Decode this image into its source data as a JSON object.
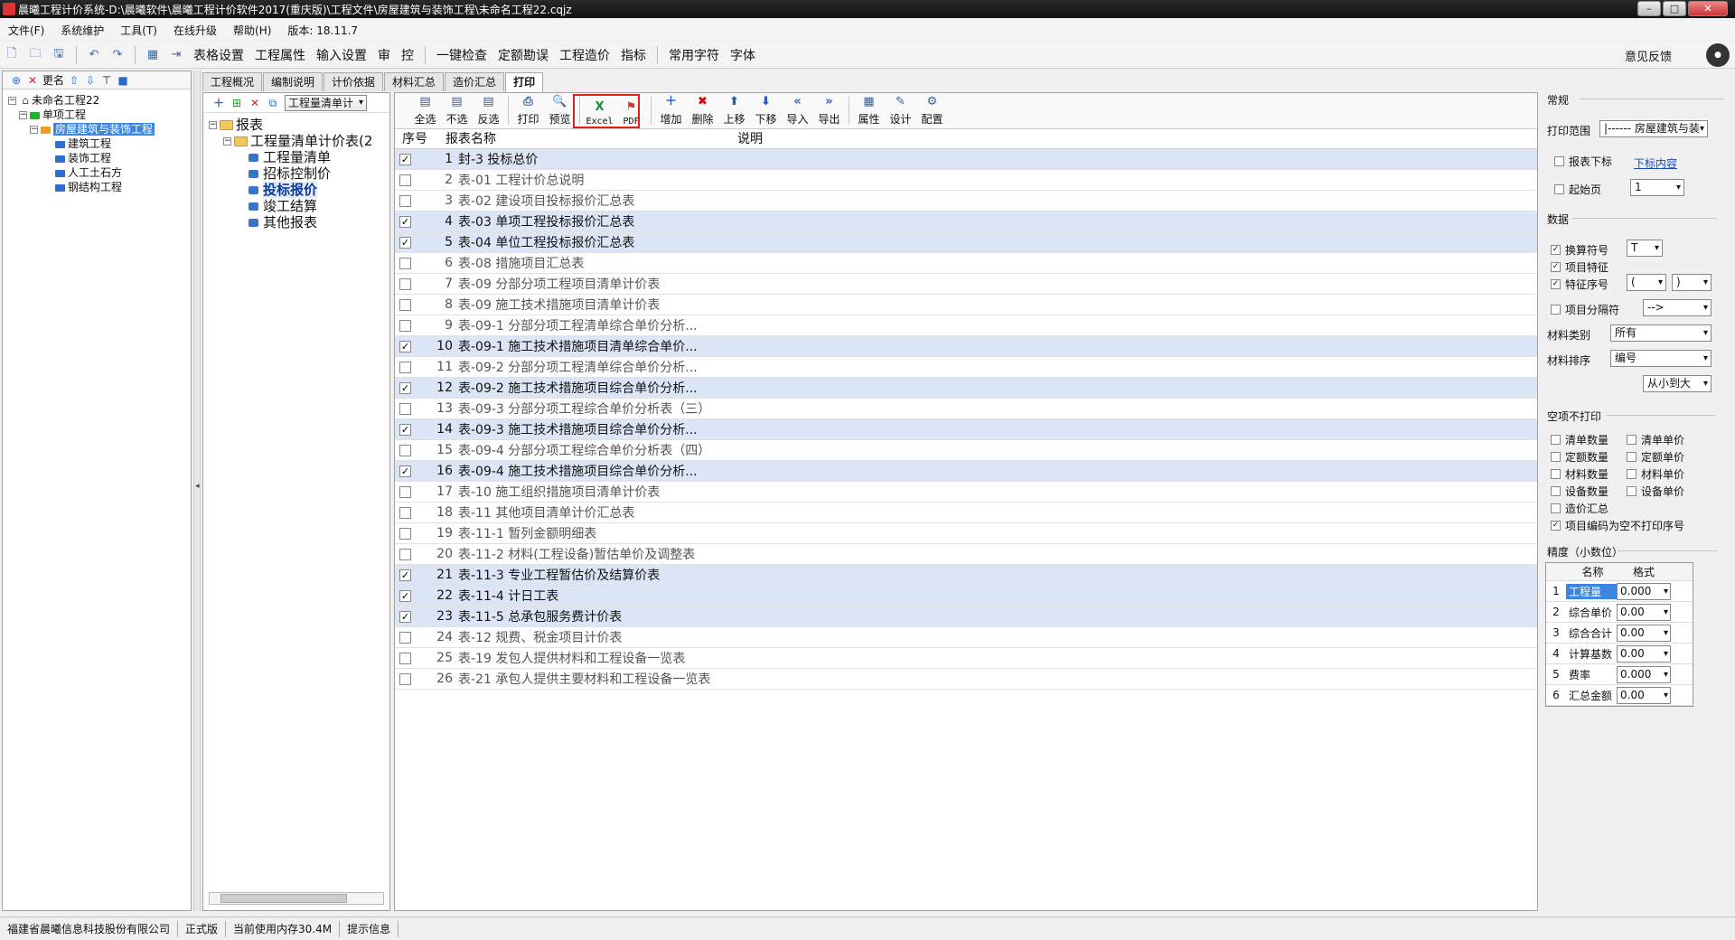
{
  "window": {
    "title": "晨曦工程计价系统-D:\\晨曦软件\\晨曦工程计价软件2017(重庆版)\\工程文件\\房屋建筑与装饰工程\\未命名工程22.cqjz"
  },
  "menu": [
    "文件(F)",
    "系统维护",
    "工具(T)",
    "在线升级",
    "帮助(H)",
    "版本: 18.11.7"
  ],
  "toolbar": {
    "items": [
      "表格设置",
      "工程属性",
      "输入设置",
      "审",
      "控",
      "一键检查",
      "定额勘误",
      "工程造价",
      "指标",
      "常用字符",
      "字体"
    ],
    "feedback": "意见反馈"
  },
  "left_tree": {
    "toolbar_label": "更名",
    "nodes": [
      {
        "label": "未命名工程22",
        "level": 0
      },
      {
        "label": "单项工程",
        "level": 1
      },
      {
        "label": "房屋建筑与装饰工程",
        "level": 2,
        "selected": true
      },
      {
        "label": "建筑工程",
        "level": 3
      },
      {
        "label": "装饰工程",
        "level": 3
      },
      {
        "label": "人工土石方",
        "level": 3
      },
      {
        "label": "钢结构工程",
        "level": 3
      }
    ]
  },
  "tabs": [
    "工程概况",
    "编制说明",
    "计价依据",
    "材料汇总",
    "造价汇总",
    "打印"
  ],
  "middle": {
    "combo": "工程量清单计",
    "tree": [
      {
        "label": "报表",
        "level": 0
      },
      {
        "label": "工程量清单计价表(2",
        "level": 1
      },
      {
        "label": "工程量清单",
        "level": 2
      },
      {
        "label": "招标控制价",
        "level": 2
      },
      {
        "label": "投标报价",
        "level": 2,
        "selected": true
      },
      {
        "label": "竣工结算",
        "level": 2
      },
      {
        "label": "其他报表",
        "level": 2
      }
    ]
  },
  "report_toolbar": [
    "全选",
    "不选",
    "反选",
    "打印",
    "预览",
    "Excel",
    "PDF",
    "增加",
    "删除",
    "上移",
    "下移",
    "导入",
    "导出",
    "属性",
    "设计",
    "配置"
  ],
  "grid": {
    "headers": {
      "no": "序号",
      "name": "报表名称",
      "desc": "说明"
    },
    "rows": [
      {
        "no": "1",
        "name": "封-3 投标总价",
        "checked": true
      },
      {
        "no": "2",
        "name": "表-01 工程计价总说明",
        "checked": false
      },
      {
        "no": "3",
        "name": "表-02 建设项目投标报价汇总表",
        "checked": false
      },
      {
        "no": "4",
        "name": "表-03 单项工程投标报价汇总表",
        "checked": true
      },
      {
        "no": "5",
        "name": "表-04 单位工程投标报价汇总表",
        "checked": true
      },
      {
        "no": "6",
        "name": "表-08 措施项目汇总表",
        "checked": false
      },
      {
        "no": "7",
        "name": "表-09 分部分项工程项目清单计价表",
        "checked": false
      },
      {
        "no": "8",
        "name": "表-09 施工技术措施项目清单计价表",
        "checked": false
      },
      {
        "no": "9",
        "name": "表-09-1 分部分项工程清单综合单价分析...",
        "checked": false
      },
      {
        "no": "10",
        "name": "表-09-1 施工技术措施项目清单综合单价...",
        "checked": true
      },
      {
        "no": "11",
        "name": "表-09-2 分部分项工程清单综合单价分析...",
        "checked": false
      },
      {
        "no": "12",
        "name": "表-09-2 施工技术措施项目综合单价分析...",
        "checked": true
      },
      {
        "no": "13",
        "name": "表-09-3 分部分项工程综合单价分析表（三）",
        "checked": false
      },
      {
        "no": "14",
        "name": "表-09-3 施工技术措施项目综合单价分析...",
        "checked": true
      },
      {
        "no": "15",
        "name": "表-09-4 分部分项工程综合单价分析表（四）",
        "checked": false
      },
      {
        "no": "16",
        "name": "表-09-4 施工技术措施项目综合单价分析...",
        "checked": true
      },
      {
        "no": "17",
        "name": "表-10 施工组织措施项目清单计价表",
        "checked": false
      },
      {
        "no": "18",
        "name": "表-11 其他项目清单计价汇总表",
        "checked": false
      },
      {
        "no": "19",
        "name": "表-11-1 暂列金额明细表",
        "checked": false
      },
      {
        "no": "20",
        "name": "表-11-2 材料(工程设备)暂估单价及调整表",
        "checked": false
      },
      {
        "no": "21",
        "name": "表-11-3 专业工程暂估价及结算价表",
        "checked": true
      },
      {
        "no": "22",
        "name": "表-11-4 计日工表",
        "checked": true
      },
      {
        "no": "23",
        "name": "表-11-5 总承包服务费计价表",
        "checked": true
      },
      {
        "no": "24",
        "name": "表-12 规费、税金项目计价表",
        "checked": false
      },
      {
        "no": "25",
        "name": "表-19 发包人提供材料和工程设备一览表",
        "checked": false
      },
      {
        "no": "26",
        "name": "表-21 承包人提供主要材料和工程设备一览表",
        "checked": false
      }
    ]
  },
  "right": {
    "general": "常规",
    "print_range_label": "打印范围",
    "print_range_value": "|------ 房屋建筑与装",
    "report_subscript": "报表下标",
    "subscript_link": "下标内容",
    "start_page": "起始页",
    "start_page_value": "1",
    "data": "数据",
    "conv_symbol": "换算符号",
    "conv_symbol_value": "T",
    "item_feature": "项目特征",
    "feature_seq": "特征序号",
    "feature_seq_open": "(",
    "feature_seq_close": ")",
    "item_separator": "项目分隔符",
    "item_separator_value": "-->",
    "material_type_label": "材料类别",
    "material_type_value": "所有",
    "material_sort_label": "材料排序",
    "material_sort_value": "编号",
    "sort_order_value": "从小到大",
    "empty_no_print": "空项不打印",
    "empty_items": [
      {
        "label": "清单数量",
        "checked": false
      },
      {
        "label": "清单单价",
        "checked": false
      },
      {
        "label": "定额数量",
        "checked": false
      },
      {
        "label": "定额单价",
        "checked": false
      },
      {
        "label": "材料数量",
        "checked": false
      },
      {
        "label": "材料单价",
        "checked": false
      },
      {
        "label": "设备数量",
        "checked": false
      },
      {
        "label": "设备单价",
        "checked": false
      },
      {
        "label": "造价汇总",
        "checked": false
      },
      {
        "label": "项目编码为空不打印序号",
        "checked": true
      }
    ],
    "precision": "精度（小数位）",
    "prec_headers": {
      "name": "名称",
      "format": "格式"
    },
    "prec_rows": [
      {
        "no": "1",
        "name": "工程量",
        "value": "0.000"
      },
      {
        "no": "2",
        "name": "综合单价",
        "value": "0.00"
      },
      {
        "no": "3",
        "name": "综合合计",
        "value": "0.00"
      },
      {
        "no": "4",
        "name": "计算基数",
        "value": "0.00"
      },
      {
        "no": "5",
        "name": "费率",
        "value": "0.000"
      },
      {
        "no": "6",
        "name": "汇总金额",
        "value": "0.00"
      }
    ]
  },
  "status": [
    "福建省晨曦信息科技股份有限公司",
    "正式版",
    "当前使用内存30.4M",
    "提示信息"
  ]
}
